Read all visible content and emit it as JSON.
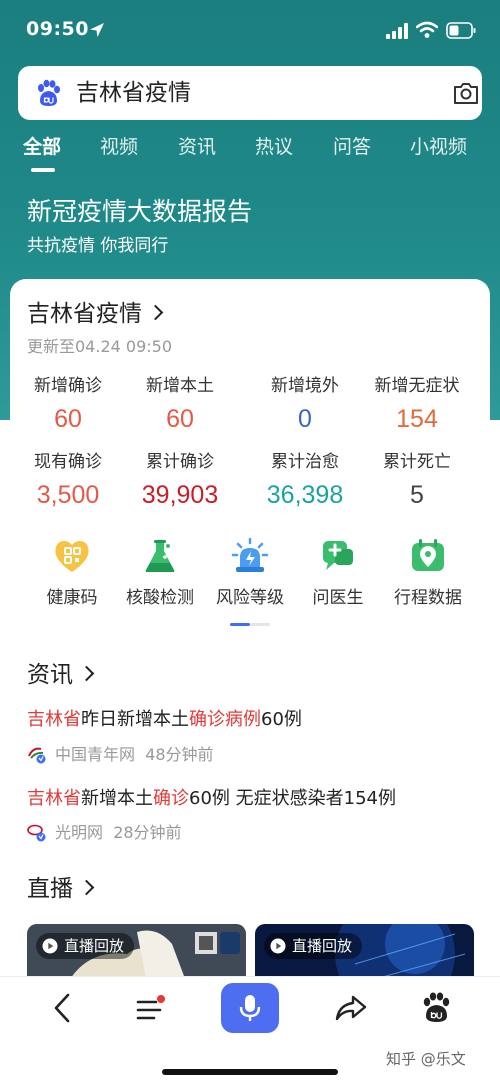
{
  "status_bar": {
    "time": "09:50"
  },
  "search": {
    "query": "吉林省疫情"
  },
  "tabs": [
    {
      "label": "全部"
    },
    {
      "label": "视频"
    },
    {
      "label": "资讯"
    },
    {
      "label": "热议"
    },
    {
      "label": "问答"
    },
    {
      "label": "小视频"
    }
  ],
  "hero": {
    "title": "新冠疫情大数据报告",
    "subtitle": "共抗疫情 你我同行"
  },
  "card": {
    "title": "吉林省疫情",
    "updated": "更新至04.24 09:50",
    "stats": [
      {
        "label": "新增确诊",
        "value": "60",
        "color": "#e25a4a"
      },
      {
        "label": "新增本土",
        "value": "60",
        "color": "#e25a4a"
      },
      {
        "label": "新增境外",
        "value": "0",
        "color": "#3a66c4"
      },
      {
        "label": "新增无症状",
        "value": "154",
        "color": "#e46a3a"
      },
      {
        "label": "现有确诊",
        "value": "3,500",
        "color": "#e25a4a"
      },
      {
        "label": "累计确诊",
        "value": "39,903",
        "color": "#c8202a"
      },
      {
        "label": "累计治愈",
        "value": "36,398",
        "color": "#1ba3a0"
      },
      {
        "label": "累计死亡",
        "value": "5",
        "color": "#444444"
      }
    ],
    "quick_actions": [
      {
        "label": "健康码",
        "icon": "health-code-icon"
      },
      {
        "label": "核酸检测",
        "icon": "flask-icon"
      },
      {
        "label": "风险等级",
        "icon": "alarm-light-icon"
      },
      {
        "label": "问医生",
        "icon": "doctor-chat-icon"
      },
      {
        "label": "行程数据",
        "icon": "location-calendar-icon"
      }
    ],
    "pager": {
      "pages": 2,
      "current": 1
    }
  },
  "news": {
    "title": "资讯",
    "items": [
      {
        "seg": [
          "吉林省",
          "昨日新增本土",
          "确诊病例",
          "60例"
        ],
        "source": "中国青年网",
        "time": "48分钟前"
      },
      {
        "seg": [
          "吉林省",
          "新增本土",
          "确诊",
          "60例 无症状感染者154例"
        ],
        "source": "光明网",
        "time": "28分钟前"
      }
    ]
  },
  "live": {
    "title": "直播",
    "badges": [
      "直播回放",
      "直播回放"
    ]
  },
  "watermark": "知乎 @乐文",
  "colors": {
    "accent": "#1f8a89",
    "highlight": "#e23a36",
    "mic": "#4e6ef2"
  }
}
